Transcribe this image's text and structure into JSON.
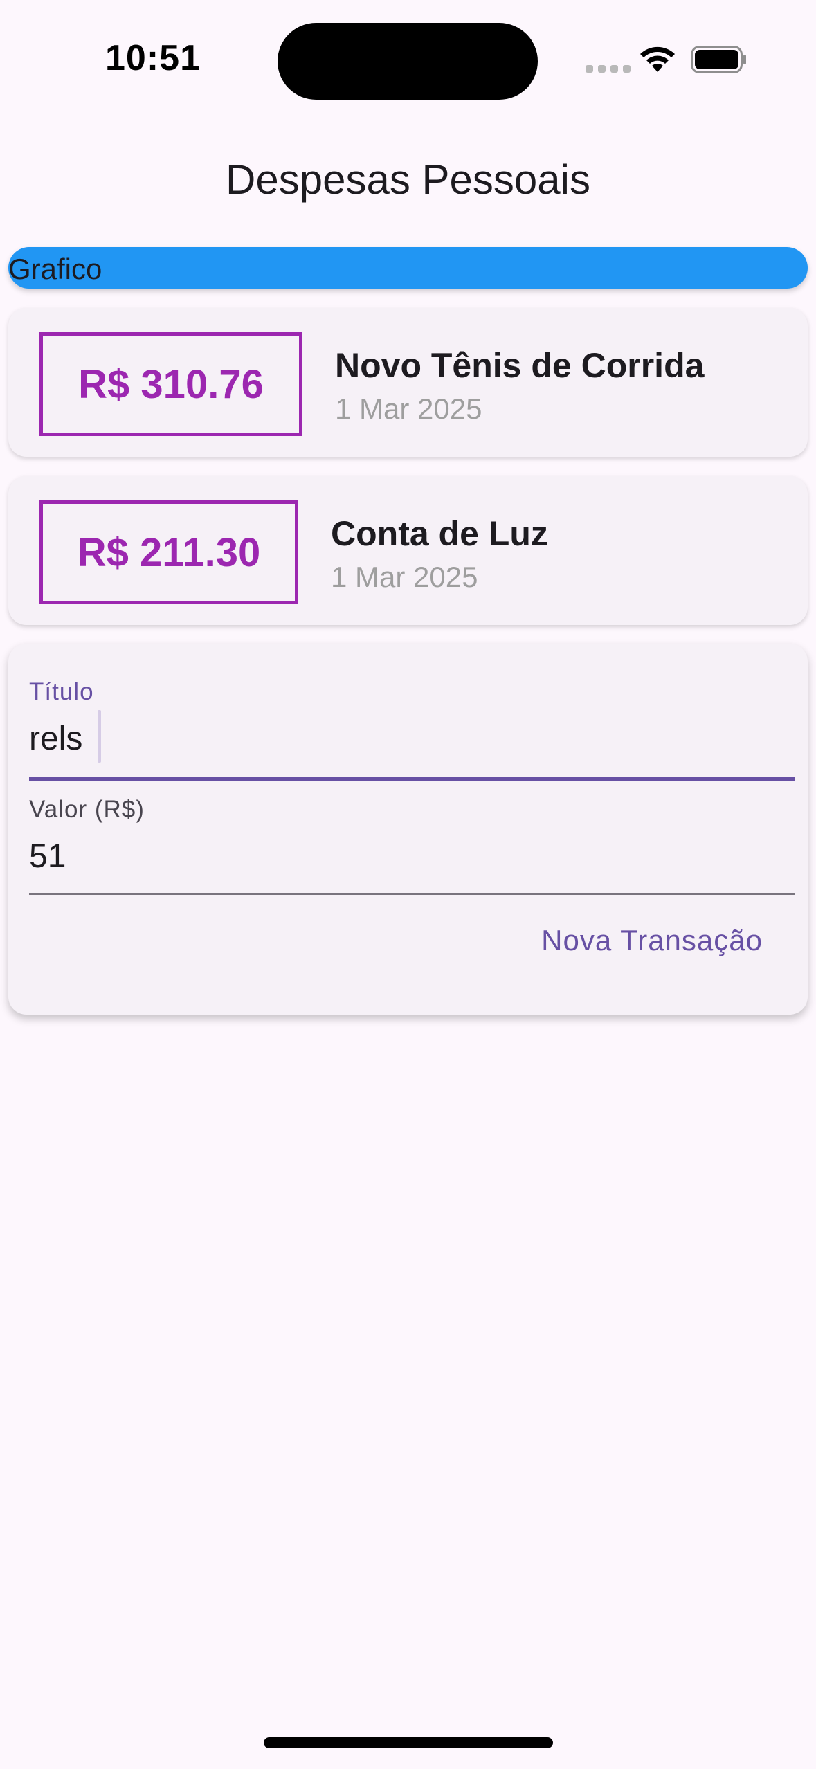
{
  "status_bar": {
    "time": "10:51",
    "icons": [
      "signal-icon",
      "wifi-icon",
      "battery-icon"
    ]
  },
  "app_bar": {
    "title": "Despesas Pessoais"
  },
  "chart": {
    "label": "Grafico",
    "color": "#2196f3"
  },
  "transactions": [
    {
      "amount": "R$ 310.76",
      "title": "Novo Tênis de Corrida",
      "date": "1 Mar 2025"
    },
    {
      "amount": "R$ 211.30",
      "title": "Conta de Luz",
      "date": "1 Mar 2025"
    }
  ],
  "form": {
    "title_field": {
      "label": "Título",
      "value": "rels"
    },
    "value_field": {
      "label": "Valor (R$)",
      "value": "51"
    },
    "submit_label": "Nova Transação"
  },
  "colors": {
    "accent": "#6750a4",
    "amount": "#9c27b0",
    "background": "#fdf7fd",
    "card": "#f6f1f7"
  }
}
